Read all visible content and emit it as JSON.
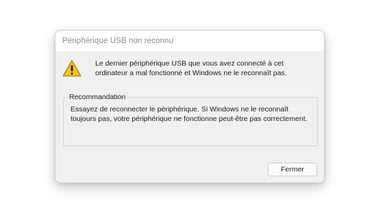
{
  "dialog": {
    "title": "Périphérique USB non reconnu",
    "icon": "warning-icon",
    "message": "Le dernier périphérique USB que vous avez connecté à cet ordinateur a mal fonctionné et Windows ne le reconnaît pas.",
    "recommendation": {
      "label": "Recommandation",
      "text": "Essayez de reconnecter le périphérique. Si Windows ne le reconnaît toujours pas, votre périphérique ne fonctionne peut-être pas correctement."
    },
    "close_label": "Fermer"
  },
  "colors": {
    "warning_yellow": "#f5c518",
    "warning_outline": "#9a7a00",
    "dialog_background": "#f0f0f0",
    "titlebar_background": "#ffffff",
    "title_text": "#8a8a8a"
  }
}
